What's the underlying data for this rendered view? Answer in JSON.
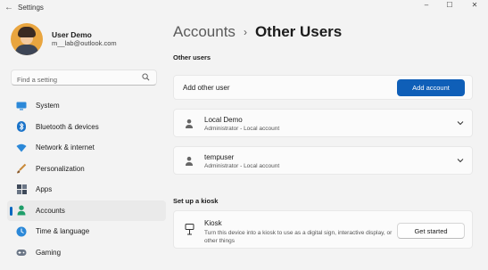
{
  "window": {
    "title": "Settings",
    "minimize_glyph": "–",
    "maximize_glyph": "☐",
    "close_glyph": "✕"
  },
  "profile": {
    "name": "User Demo",
    "email": "m__lab@outlook.com"
  },
  "search": {
    "placeholder": "Find a setting"
  },
  "nav": {
    "items": [
      {
        "label": "System",
        "icon": "monitor-icon",
        "selected": false
      },
      {
        "label": "Bluetooth & devices",
        "icon": "bluetooth-icon",
        "selected": false
      },
      {
        "label": "Network & internet",
        "icon": "wifi-icon",
        "selected": false
      },
      {
        "label": "Personalization",
        "icon": "brush-icon",
        "selected": false
      },
      {
        "label": "Apps",
        "icon": "apps-icon",
        "selected": false
      },
      {
        "label": "Accounts",
        "icon": "person-icon",
        "selected": true
      },
      {
        "label": "Time & language",
        "icon": "globe-clock-icon",
        "selected": false
      },
      {
        "label": "Gaming",
        "icon": "gamepad-icon",
        "selected": false
      }
    ]
  },
  "breadcrumb": {
    "parent": "Accounts",
    "separator": "›",
    "current": "Other Users"
  },
  "other_users": {
    "section_label": "Other users",
    "add_label": "Add other user",
    "add_button": "Add account",
    "users": [
      {
        "name": "Local Demo",
        "role": "Administrator - Local account"
      },
      {
        "name": "tempuser",
        "role": "Administrator - Local account"
      }
    ]
  },
  "kiosk": {
    "section_label": "Set up a kiosk",
    "title": "Kiosk",
    "description": "Turn this device into a kiosk to use as a digital sign, interactive display, or other things",
    "button": "Get started"
  },
  "colors": {
    "accent": "#0067c0",
    "primary_button": "#0f5fb8",
    "background": "#f3f3f3",
    "card": "#fbfbfb"
  }
}
